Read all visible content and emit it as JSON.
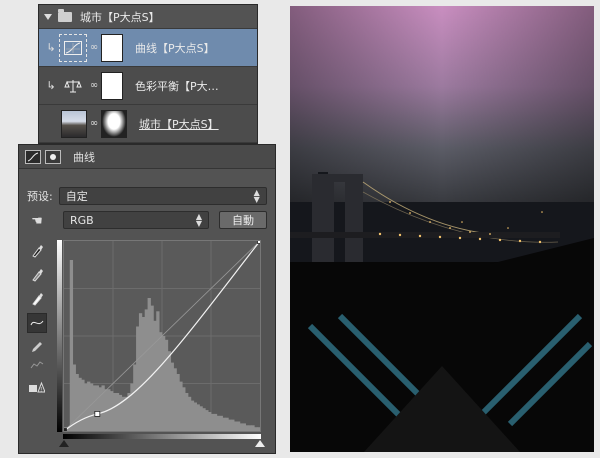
{
  "layers": {
    "group": {
      "name": "城市【P大点S】"
    },
    "items": [
      {
        "name": "曲线【P大点S】",
        "type": "curves-adjustment",
        "selected": true
      },
      {
        "name": "色彩平衡【P大…",
        "type": "color-balance-adjustment",
        "selected": false
      },
      {
        "name": "城市【P大点S】",
        "type": "image-layer",
        "selected": false
      }
    ]
  },
  "properties": {
    "title": "曲线",
    "preset_label": "预设:",
    "preset_value": "自定",
    "channel_value": "RGB",
    "auto_button": "自動"
  },
  "curve": {
    "points": [
      [
        0,
        0
      ],
      [
        0.17,
        0.09
      ],
      [
        1,
        1
      ]
    ],
    "histogram": [
      0.02,
      0.02,
      0.9,
      0.35,
      0.3,
      0.28,
      0.27,
      0.25,
      0.26,
      0.25,
      0.24,
      0.24,
      0.23,
      0.24,
      0.22,
      0.22,
      0.21,
      0.2,
      0.2,
      0.19,
      0.18,
      0.18,
      0.2,
      0.25,
      0.35,
      0.55,
      0.62,
      0.6,
      0.64,
      0.7,
      0.66,
      0.58,
      0.63,
      0.52,
      0.5,
      0.48,
      0.42,
      0.36,
      0.33,
      0.3,
      0.26,
      0.23,
      0.2,
      0.18,
      0.16,
      0.15,
      0.14,
      0.13,
      0.12,
      0.11,
      0.1,
      0.09,
      0.09,
      0.08,
      0.08,
      0.07,
      0.07,
      0.06,
      0.06,
      0.05,
      0.05,
      0.04,
      0.04,
      0.03,
      0.03,
      0.03,
      0.02,
      0.02
    ]
  },
  "colors": {
    "selection": "#6f8bad",
    "sky_top": "#c98ec0",
    "lights": "#f3c36b",
    "accent_stripes": "#2f6f82"
  }
}
